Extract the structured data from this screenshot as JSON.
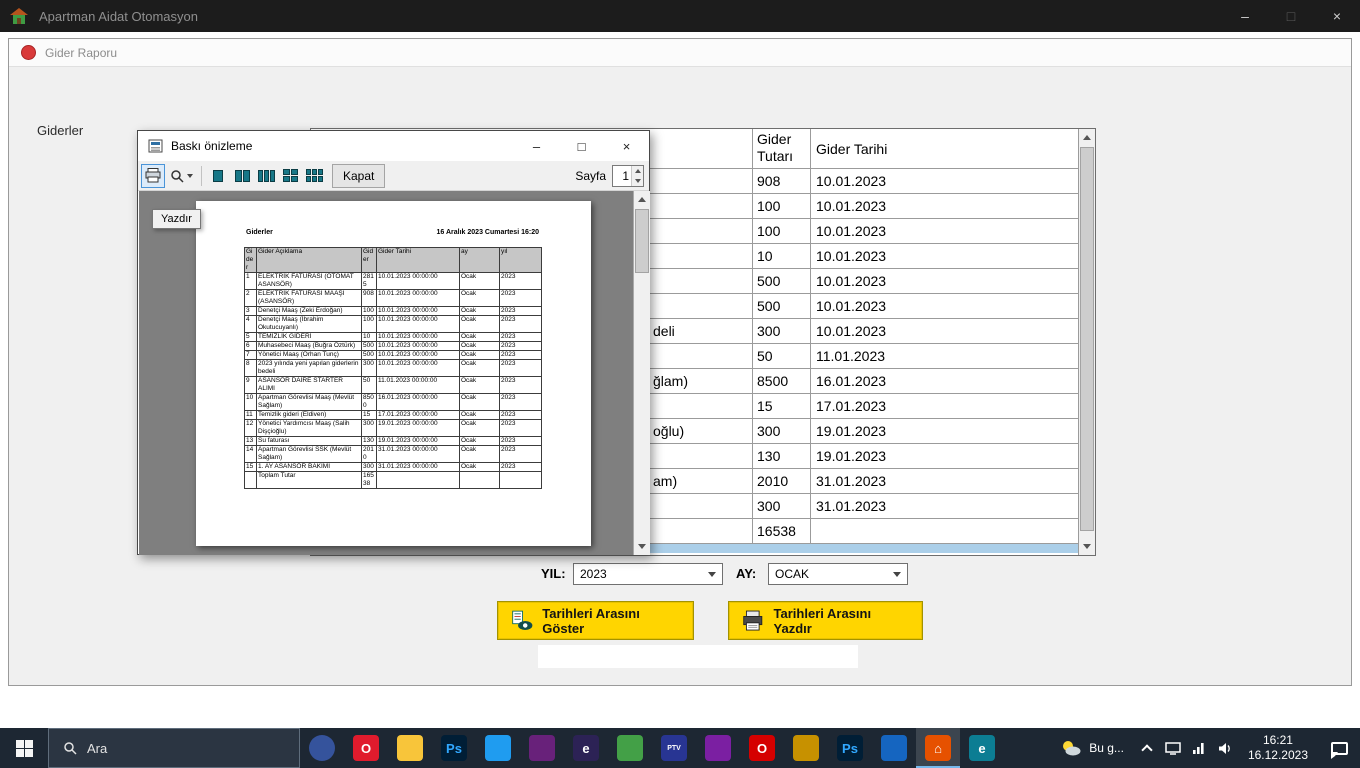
{
  "app": {
    "title": "Apartman Aidat Otomasyon",
    "controls": {
      "minimize": "–",
      "maximize": "□",
      "close": "×"
    }
  },
  "report_window": {
    "title": "Gider Raporu",
    "section_label": "Giderler"
  },
  "grid": {
    "columns": {
      "amount": "Gider Tutarı",
      "date": "Gider Tarihi"
    },
    "rows": [
      {
        "tail": "",
        "amount": "908",
        "date": "10.01.2023"
      },
      {
        "tail": "",
        "amount": "100",
        "date": "10.01.2023"
      },
      {
        "tail": "",
        "amount": "100",
        "date": "10.01.2023"
      },
      {
        "tail": "",
        "amount": "10",
        "date": "10.01.2023"
      },
      {
        "tail": "",
        "amount": "500",
        "date": "10.01.2023"
      },
      {
        "tail": "",
        "amount": "500",
        "date": "10.01.2023"
      },
      {
        "tail": "deli",
        "amount": "300",
        "date": "10.01.2023"
      },
      {
        "tail": "",
        "amount": "50",
        "date": "11.01.2023"
      },
      {
        "tail": "ğlam)",
        "amount": "8500",
        "date": "16.01.2023"
      },
      {
        "tail": "",
        "amount": "15",
        "date": "17.01.2023"
      },
      {
        "tail": "oğlu)",
        "amount": "300",
        "date": "19.01.2023"
      },
      {
        "tail": "",
        "amount": "130",
        "date": "19.01.2023"
      },
      {
        "tail": "am)",
        "amount": "2010",
        "date": "31.01.2023"
      },
      {
        "tail": "",
        "amount": "300",
        "date": "31.01.2023"
      },
      {
        "tail": "",
        "amount": "16538",
        "date": ""
      }
    ]
  },
  "preview": {
    "title": "Baskı önizleme",
    "controls": {
      "minimize": "–",
      "maximize": "□",
      "close": "×"
    },
    "toolbar": {
      "close": "Kapat",
      "page_label": "Sayfa",
      "page_value": "1"
    },
    "tooltip": "Yazdır",
    "report": {
      "title": "Giderler",
      "printed_at": "16 Aralık 2023 Cumartesi 16:20",
      "columns": [
        "Gider",
        "Gider Açıklama",
        "Gider",
        "Gider Tarihi",
        "ay",
        "yıl"
      ],
      "rows": [
        [
          "1",
          "ELEKTRİK FATURASI (OTOMAT ASANSÖR)",
          "2815",
          "10.01.2023 00:00:00",
          "Ocak",
          "2023"
        ],
        [
          "2",
          "ELEKTRİK FATURASI MAAŞI (ASANSÖR)",
          "908",
          "10.01.2023 00:00:00",
          "Ocak",
          "2023"
        ],
        [
          "3",
          "Denetçi Maaş (Zeki Erdoğan)",
          "100",
          "10.01.2023 00:00:00",
          "Ocak",
          "2023"
        ],
        [
          "4",
          "Denetçi Maaş (İbrahim Okutucuyanlı)",
          "100",
          "10.01.2023 00:00:00",
          "Ocak",
          "2023"
        ],
        [
          "5",
          "TEMİZLİK GİDERİ",
          "10",
          "10.01.2023 00:00:00",
          "Ocak",
          "2023"
        ],
        [
          "6",
          "Muhasebeci Maaş (Buğra Öztürk)",
          "500",
          "10.01.2023 00:00:00",
          "Ocak",
          "2023"
        ],
        [
          "7",
          "Yönetici Maaş (Orhan Tunç)",
          "500",
          "10.01.2023 00:00:00",
          "Ocak",
          "2023"
        ],
        [
          "8",
          "2023 yılında yeni yapılan giderlerin bedeli",
          "300",
          "10.01.2023 00:00:00",
          "Ocak",
          "2023"
        ],
        [
          "9",
          "ASANSÖR DAİRE STARTER ALIMI",
          "50",
          "11.01.2023 00:00:00",
          "Ocak",
          "2023"
        ],
        [
          "10",
          "Apartman Görevlisi Maaş (Mevlüt Sağlam)",
          "8500",
          "16.01.2023 00:00:00",
          "Ocak",
          "2023"
        ],
        [
          "11",
          "Temizlik gideri (Eldiven)",
          "15",
          "17.01.2023 00:00:00",
          "Ocak",
          "2023"
        ],
        [
          "12",
          "Yönetici Yardımcısı Maaş (Salih Dişçioğlu)",
          "300",
          "19.01.2023 00:00:00",
          "Ocak",
          "2023"
        ],
        [
          "13",
          "Su faturası",
          "130",
          "19.01.2023 00:00:00",
          "Ocak",
          "2023"
        ],
        [
          "14",
          "Apartman Görevlisi SSK (Mevlüt Sağlam)",
          "2010",
          "31.01.2023 00:00:00",
          "Ocak",
          "2023"
        ],
        [
          "15",
          "1. AY ASANSÖR BAKIMI",
          "300",
          "31.01.2023 00:00:00",
          "Ocak",
          "2023"
        ],
        [
          "",
          "Toplam Tutar",
          "16538",
          "",
          "",
          ""
        ]
      ]
    }
  },
  "filters": {
    "year_label": "YIL:",
    "year_value": "2023",
    "month_label": "AY:",
    "month_value": "OCAK"
  },
  "actions": {
    "show_label": "Tarihleri Arasını Göster",
    "print_label": "Tarihleri Arasını Yazdır"
  },
  "taskbar": {
    "search_placeholder": "Ara",
    "weather_text": "Bu g...",
    "time": "16:21",
    "date": "16.12.2023",
    "apps": [
      {
        "name": "university-logo-icon",
        "label": "",
        "color": "#35539c",
        "round": true
      },
      {
        "name": "opera-icon",
        "label": "O",
        "color": "#e01b2d"
      },
      {
        "name": "file-explorer-icon",
        "label": "",
        "color": "#f8c53a"
      },
      {
        "name": "photoshop-icon",
        "label": "Ps",
        "color": "#001e36",
        "fg": "#31a8ff"
      },
      {
        "name": "vscode-icon",
        "label": "",
        "color": "#1f9cf0"
      },
      {
        "name": "visual-studio-icon",
        "label": "",
        "color": "#68217a"
      },
      {
        "name": "eclipse-icon",
        "label": "e",
        "color": "#2c2255"
      },
      {
        "name": "app-grid-icon",
        "label": "",
        "color": "#43a047"
      },
      {
        "name": "ptv-icon",
        "label": "PTV",
        "color": "#283593",
        "small": true
      },
      {
        "name": "netbeans-icon",
        "label": "",
        "color": "#7b1fa2"
      },
      {
        "name": "opera-gx-icon",
        "label": "O",
        "color": "#d50000"
      },
      {
        "name": "game-icon",
        "label": "",
        "color": "#c79100"
      },
      {
        "name": "photoshop-2-icon",
        "label": "Ps",
        "color": "#001e36",
        "fg": "#31a8ff"
      },
      {
        "name": "photos-icon",
        "label": "",
        "color": "#1565c0"
      },
      {
        "name": "apartman-app-icon",
        "label": "⌂",
        "color": "#e65100",
        "active": true
      },
      {
        "name": "edge-icon",
        "label": "e",
        "color": "#0c7d93"
      }
    ]
  }
}
